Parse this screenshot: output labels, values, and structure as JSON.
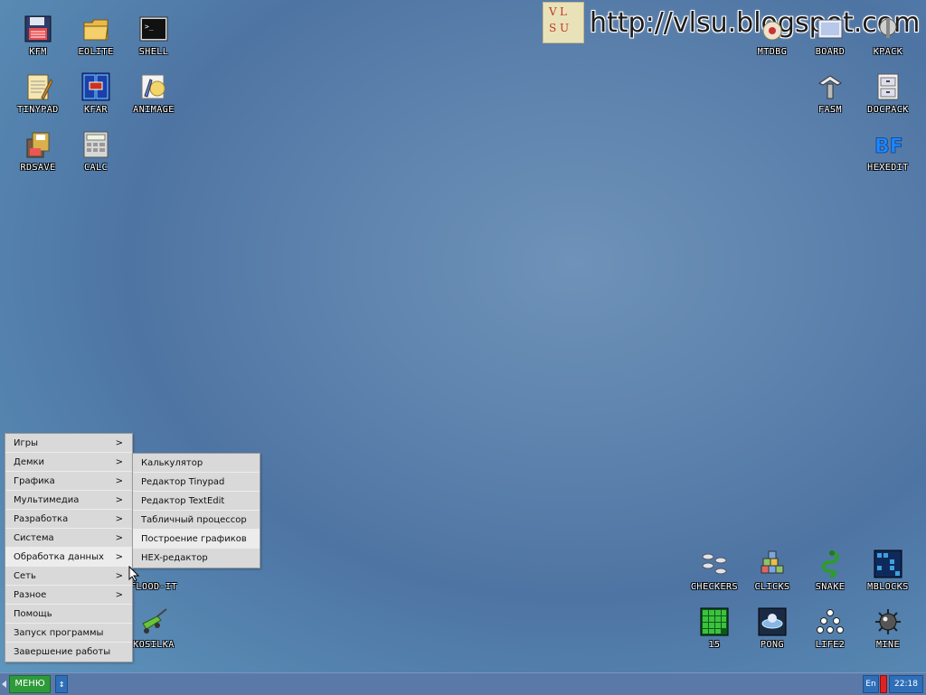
{
  "watermark": {
    "logo_letters": [
      "V",
      "L",
      "S",
      "U"
    ],
    "url": "http://vlsu.blogspot.com"
  },
  "desktop_icons": {
    "kfm": "KFM",
    "eolite": "EOLITE",
    "shell": "SHELL",
    "tinypad": "TINYPAD",
    "kfar": "KFAR",
    "animage": "ANIMAGE",
    "rdsave": "RDSAVE",
    "calc": "CALC",
    "mtdbg": "MTDBG",
    "board": "BOARD",
    "kpack": "KPACK",
    "fasm": "FASM",
    "docpack": "DOCPACK",
    "hexedit": "HEXEDIT",
    "flood_it": "FLOOD-IT",
    "kosilka": "KOSILKA",
    "checkers": "CHECKERS",
    "clicks": "CLICKS",
    "snake": "SNAKE",
    "mblocks": "MBLOCKS",
    "n15": "15",
    "pong": "PONG",
    "life2": "LIFE2",
    "mine": "MINE"
  },
  "main_menu": {
    "items": [
      {
        "label": "Игры",
        "arrow": ">"
      },
      {
        "label": "Демки",
        "arrow": ">"
      },
      {
        "label": "Графика",
        "arrow": ">"
      },
      {
        "label": "Мультимедиа",
        "arrow": ">"
      },
      {
        "label": "Разработка",
        "arrow": ">"
      },
      {
        "label": "Система",
        "arrow": ">"
      },
      {
        "label": "Обработка данных",
        "arrow": ">"
      },
      {
        "label": "Сеть",
        "arrow": ">"
      },
      {
        "label": "Разное",
        "arrow": ">"
      },
      {
        "label": "Помощь"
      },
      {
        "label": "Запуск программы"
      },
      {
        "label": "Завершение работы"
      }
    ]
  },
  "sub_menu": {
    "items": [
      {
        "label": "Калькулятор"
      },
      {
        "label": "Редактор Tinypad"
      },
      {
        "label": "Редактор TextEdit"
      },
      {
        "label": "Табличный процессор"
      },
      {
        "label": "Построение графиков"
      },
      {
        "label": "HEX-редактор"
      }
    ]
  },
  "taskbar": {
    "menu_label": "МЕНЮ",
    "arrows": "↕",
    "lang": "En",
    "clock": "22:18"
  },
  "colors": {
    "menu_button": "#2f9a3a",
    "taskbar": "#5b79a8",
    "indicator": "#dd2222"
  }
}
